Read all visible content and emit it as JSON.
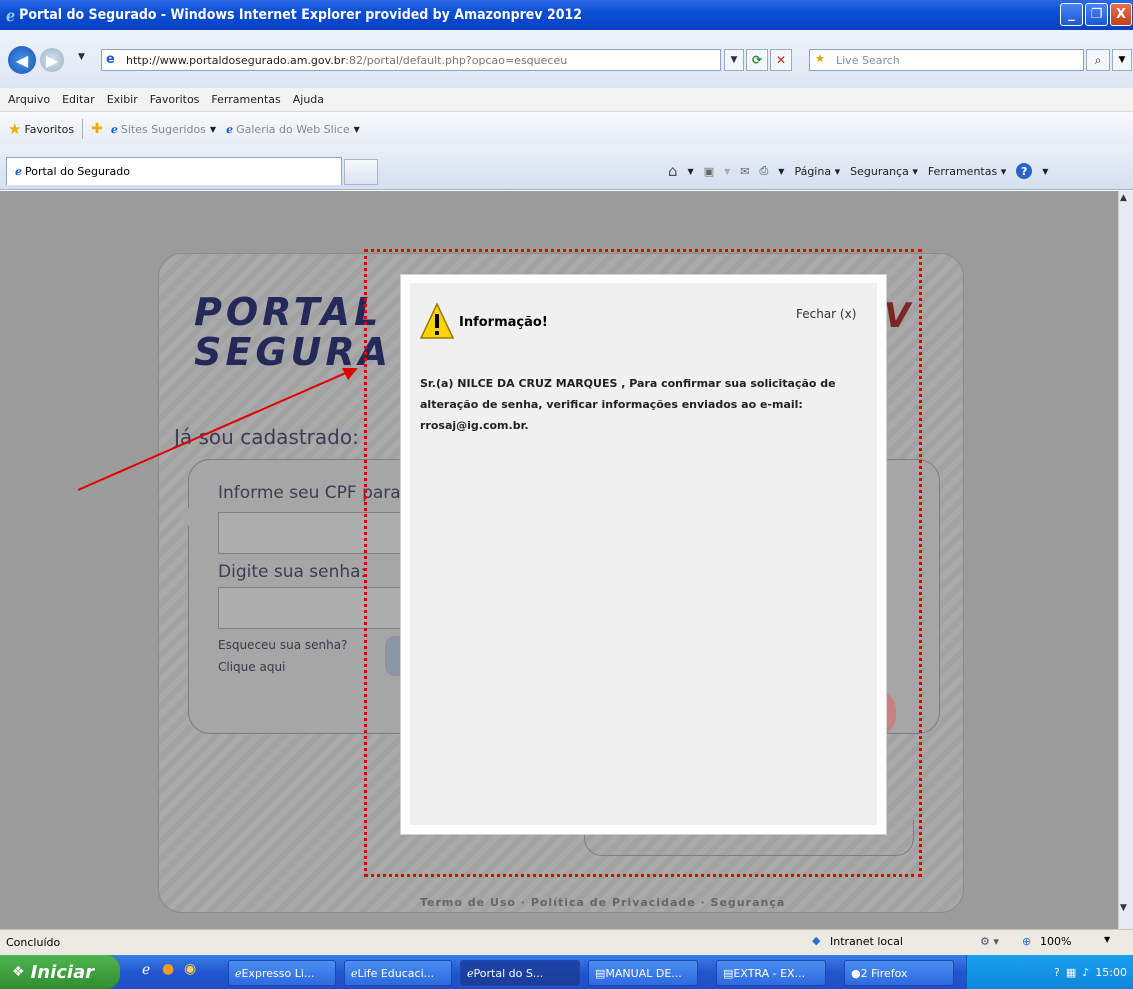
{
  "window": {
    "title": "Portal do Segurado - Windows Internet Explorer provided by Amazonprev 2012",
    "minimize": "_",
    "maximize": "❐",
    "close": "X"
  },
  "address": {
    "url_host": "http://www.portaldosegurado.am.gov.br",
    "url_rest": ":82/portal/default.php?opcao=esqueceu",
    "search_placeholder": "Live Search"
  },
  "menu": [
    "Arquivo",
    "Editar",
    "Exibir",
    "Favoritos",
    "Ferramentas",
    "Ajuda"
  ],
  "favorites": {
    "label": "Favoritos",
    "suggested": "Sites Sugeridos",
    "webslice": "Galeria do Web Slice"
  },
  "tab": {
    "title": "Portal do Segurado"
  },
  "commands": {
    "page": "Página",
    "security": "Segurança",
    "tools": "Ferramentas"
  },
  "page": {
    "logo_line1": "PORTAL",
    "logo_line2": "SEGURA",
    "logo_right": "V",
    "already_registered": "Já sou cadastrado:",
    "cpf_label": "Informe seu CPF para ac",
    "password_label": "Digite sua senha:",
    "forgot": "Esqueceu sua senha?",
    "click_here": "Clique aqui",
    "footer": "Termo de Uso · Política de Privacidade · Segurança"
  },
  "dialog": {
    "title": "Informação!",
    "close": "Fechar (x)",
    "message_line1": "Sr.(a) NILCE DA CRUZ MARQUES , Para confirmar sua solicitação de",
    "message_line2": "alteração de senha, verificar informações enviados ao e-mail:",
    "message_line3": "rrosaj@ig.com.br."
  },
  "status": {
    "text": "Concluído",
    "zone": "Intranet local",
    "zoom": "100%"
  },
  "taskbar": {
    "start": "Iniciar",
    "items": [
      "Expresso Li...",
      "Life Educaci...",
      "Portal do S...",
      "MANUAL DE...",
      "EXTRA - EX...",
      "2 Firefox"
    ],
    "clock": "15:00"
  },
  "colors": {
    "highlight": "#e00000",
    "arrow": "#e00000",
    "titlebar": "#0a4fd6"
  }
}
